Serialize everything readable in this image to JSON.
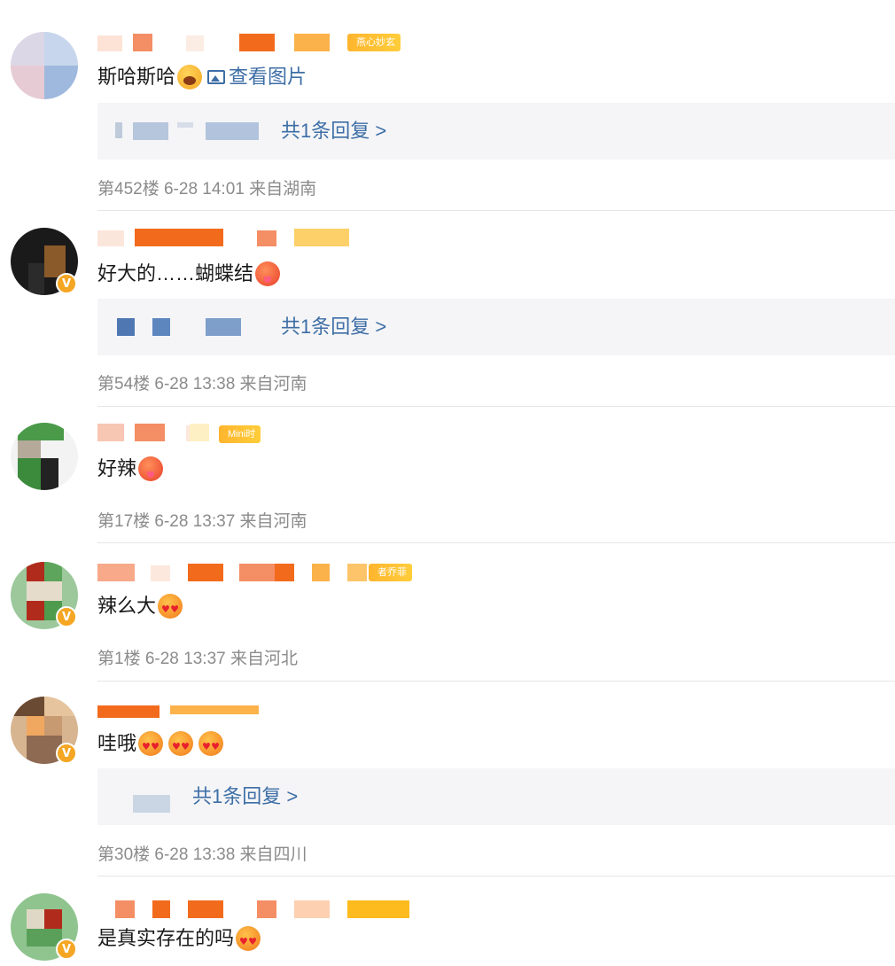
{
  "comments": [
    {
      "name_tag": "燕心妙玄",
      "text": "斯哈斯哈",
      "emojis": [
        "sweat"
      ],
      "view_image_label": "查看图片",
      "reply_label": "共1条回复 >",
      "meta": "第452楼 6-28 14:01 来自湖南"
    },
    {
      "name_tag": "",
      "text": "好大的……蝴蝶结",
      "emojis": [
        "hot"
      ],
      "reply_label": "共1条回复 >",
      "meta": "第54楼 6-28 13:38 来自河南"
    },
    {
      "name_tag": "Mini时",
      "text": "好辣",
      "emojis": [
        "hot"
      ],
      "meta": "第17楼 6-28 13:37 来自河南"
    },
    {
      "name_tag": "者乔菲",
      "text": "辣么大",
      "emojis": [
        "heart"
      ],
      "meta": "第1楼 6-28 13:37 来自河北"
    },
    {
      "name_tag": "",
      "text": "哇哦",
      "emojis": [
        "heart",
        "heart",
        "heart"
      ],
      "reply_label": "共1条回复 >",
      "meta": "第30楼 6-28 13:38 来自四川"
    },
    {
      "name_tag": "",
      "text": "是真实存在的吗",
      "emojis": [
        "heart"
      ]
    }
  ],
  "colors": {
    "link": "#3d6ea6",
    "meta": "#8b8b8b",
    "reply_bg": "#f5f5f7",
    "verified_badge": "#f5a623"
  }
}
